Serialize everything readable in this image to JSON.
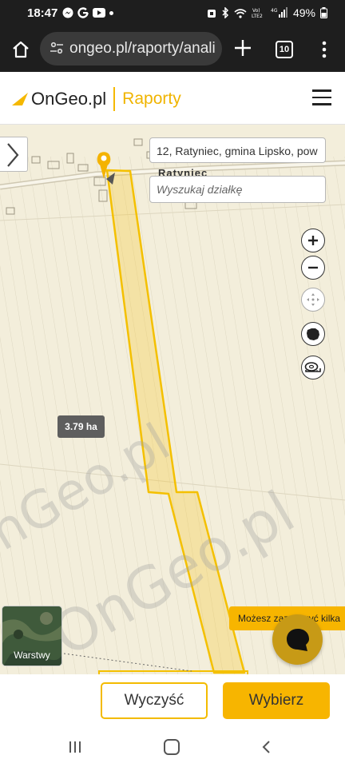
{
  "status_bar": {
    "time": "18:47",
    "battery": "49%",
    "network_icons": [
      "messenger-icon",
      "google-icon",
      "youtube-icon",
      "alarm-icon",
      "bluetooth-icon",
      "wifi-icon",
      "volte-icon",
      "signal-icon",
      "battery-icon"
    ]
  },
  "browser": {
    "url": "ongeo.pl/raporty/anali",
    "tab_count": "10"
  },
  "site": {
    "brand": "OnGeo.pl",
    "section": "Raporty",
    "accent_color": "#f5b800"
  },
  "map": {
    "address": "12, Ratyniec, gmina Lipsko, pow",
    "parcel_search_placeholder": "Wyszukaj działkę",
    "village_label": "Ratyniec",
    "area_label": "3.79 ha",
    "watermark": "OnGeo.pl",
    "layers_label": "Warstwy",
    "toast": "Możesz zaznaczyć kilka",
    "controls": [
      "zoom-in-icon",
      "zoom-out-icon",
      "locate-icon",
      "poland-map-icon",
      "measure-icon"
    ]
  },
  "actions": {
    "clear": "Wyczyść",
    "select": "Wybierz"
  }
}
